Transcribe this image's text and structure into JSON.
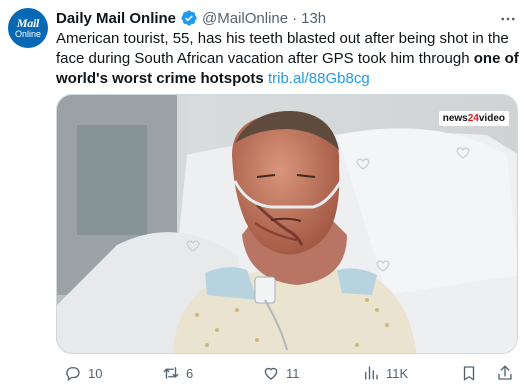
{
  "author": {
    "avatar_line1": "Mail",
    "avatar_line2": "Online",
    "name": "Daily Mail Online",
    "handle": "@MailOnline",
    "separator": "·",
    "time": "13h",
    "verified_color": "#1d9bf0"
  },
  "tweet": {
    "text_plain": "American tourist, 55, has his teeth blasted out after being shot in the face during South African vacation after GPS took him through ",
    "text_bold": "one of world's worst crime hotspots",
    "link": "trib.al/88Gb8cg"
  },
  "media": {
    "badge_prefix": "news",
    "badge_num": "24",
    "badge_suffix": "video"
  },
  "actions": {
    "replies": "10",
    "retweets": "6",
    "likes": "11",
    "views": "11K"
  },
  "colors": {
    "link": "#1d9bf0",
    "secondary_text": "#536471",
    "avatar_bg": "#0768b5"
  },
  "icons": [
    "verified-badge-icon",
    "more-options-icon",
    "reply-icon",
    "retweet-icon",
    "like-icon",
    "views-icon",
    "bookmark-icon",
    "share-icon"
  ]
}
